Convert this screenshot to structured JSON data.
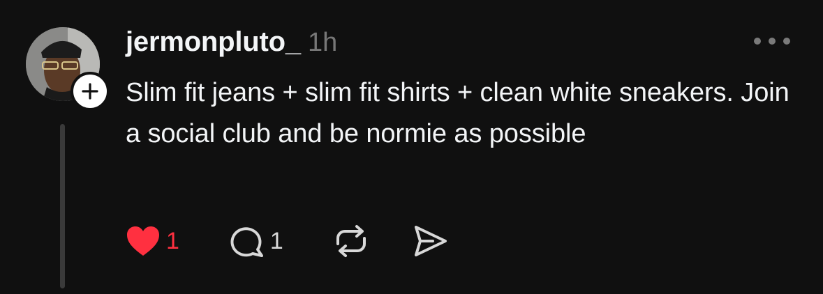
{
  "post": {
    "username": "jermonpluto_",
    "timestamp": "1h",
    "text": "Slim fit jeans + slim fit shirts + clean white sneakers. Join a social club and be normie as possible",
    "likes": "1",
    "replies": "1",
    "liked": true
  },
  "icons": {
    "more": "more-dots-icon",
    "follow": "plus-icon",
    "like": "heart-icon",
    "reply": "comment-icon",
    "repost": "repost-icon",
    "share": "send-icon"
  },
  "colors": {
    "background": "#101010",
    "like_accent": "#ff3040",
    "secondary_text": "#777777"
  }
}
